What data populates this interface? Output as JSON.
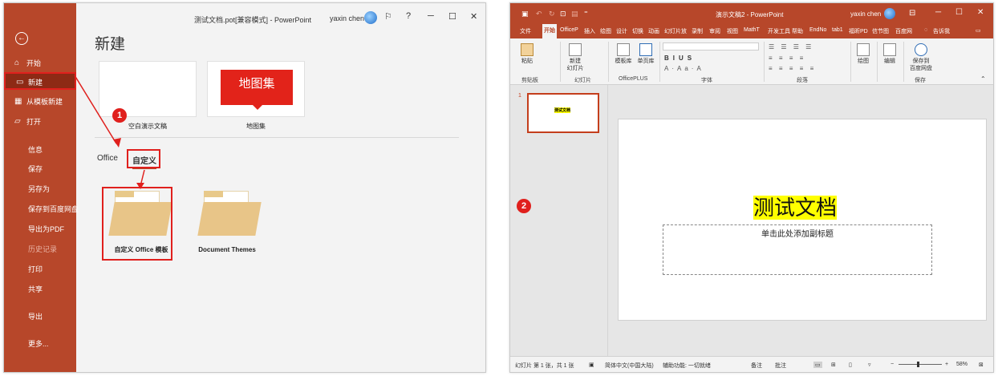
{
  "left": {
    "title": "测试文档.pot[兼容模式] - PowerPoint",
    "user": "yaxin chen",
    "window_buttons": [
      "─",
      "☐",
      "✕",
      "?"
    ],
    "heading": "新建",
    "sidebar": {
      "items": [
        {
          "label": "开始",
          "icon": "⌂"
        },
        {
          "label": "新建",
          "icon": "🗋"
        },
        {
          "label": "从模板新建",
          "icon": "▦"
        },
        {
          "label": "打开",
          "icon": "🗁"
        },
        {
          "label": "信息"
        },
        {
          "label": "保存"
        },
        {
          "label": "另存为"
        },
        {
          "label": "保存到百度网盘"
        },
        {
          "label": "导出为PDF"
        },
        {
          "label": "历史记录"
        },
        {
          "label": "打印"
        },
        {
          "label": "共享"
        },
        {
          "label": "导出"
        },
        {
          "label": "更多..."
        }
      ]
    },
    "templates": [
      {
        "label": "空白演示文稿"
      },
      {
        "label": "地图集",
        "banner": "地图集"
      }
    ],
    "tabs": [
      "Office",
      "自定义"
    ],
    "folders": [
      {
        "label": "自定义 Office 模板"
      },
      {
        "label": "Document Themes"
      }
    ],
    "badge": "1"
  },
  "right": {
    "title": "演示文稿2 - PowerPoint",
    "user": "yaxin chen",
    "tabs": [
      "文件",
      "开始",
      "OfficeP",
      "插入",
      "绘图",
      "设计",
      "切换",
      "动画",
      "幻灯片放",
      "录制",
      "审阅",
      "视图",
      "MathT",
      "开发工具",
      "帮助",
      "EndNo",
      "tab1",
      "福昕PD",
      "信节图",
      "百度网",
      "告诉我"
    ],
    "ribbon": {
      "groups": [
        "剪贴板",
        "幻灯片",
        "OfficePLUS",
        "字体",
        "段落",
        "保存"
      ],
      "buttons": [
        "粘贴",
        "新建\n幻灯片",
        "模板库",
        "单页库",
        "绘图",
        "编辑",
        "保存到\n百度网盘"
      ]
    },
    "thumb_index": "1",
    "thumb_text": "测试文档",
    "slide_title": "测试文档",
    "slide_subtitle": "单击此处添加副标题",
    "badge": "2",
    "status": {
      "slide_info": "幻灯片 第 1 张，共 1 张",
      "language": "简体中文(中国大陆)",
      "accessibility": "辅助功能: 一切就绪",
      "notes": "备注",
      "comments": "批注",
      "zoom": "58%",
      "zoom_fraction": 0.45
    }
  }
}
